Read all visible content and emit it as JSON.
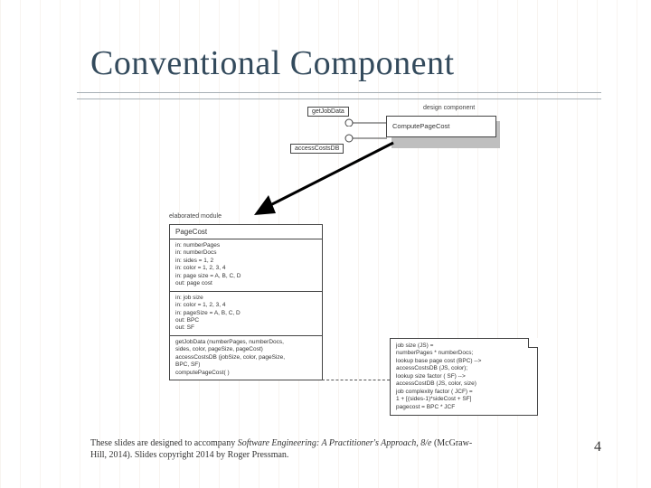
{
  "title": "Conventional Component",
  "top": {
    "stereotype": "design component",
    "component": "ComputePageCost",
    "in1": "getJobData",
    "in2": "accessCostsDB"
  },
  "elaborated": {
    "stereotype": "elaborated module",
    "name": "PageCost",
    "sec1": [
      "in: numberPages",
      "in: numberDocs",
      "in: sides = 1, 2",
      "in: color = 1, 2, 3, 4",
      "in: page size = A, B, C, D",
      "out: page cost"
    ],
    "sec2": [
      "in: job size",
      "in: color = 1, 2, 3, 4",
      "in: pageSize = A, B, C, D",
      "out: BPC",
      "out: SF"
    ],
    "sec3": [
      "getJobData (numberPages, numberDocs,",
      "sides, color, pageSize, pageCost)",
      "accessCostsDB (jobSize, color, pageSize,",
      "BPC, SF)",
      "computePageCost( )"
    ]
  },
  "note": [
    "job size (JS) =",
    "  numberPages * numberDocs;",
    "lookup base page cost (BPC) -->",
    "  accessCostsDB (JS, color);",
    "lookup size factor ( SF) -->",
    "  accessCostDB (JS, color, size)",
    "job complexity factor ( JCF) =",
    "  1 + [(sides-1)*sideCost + SF]",
    "pagecost = BPC * JCF"
  ],
  "footer_a": "These slides are designed to accompany ",
  "footer_b": "Software Engineering: A Practitioner's Approach, 8/e",
  "footer_c": " (McGraw-Hill, 2014). Slides copyright 2014 by Roger Pressman.",
  "page": "4"
}
